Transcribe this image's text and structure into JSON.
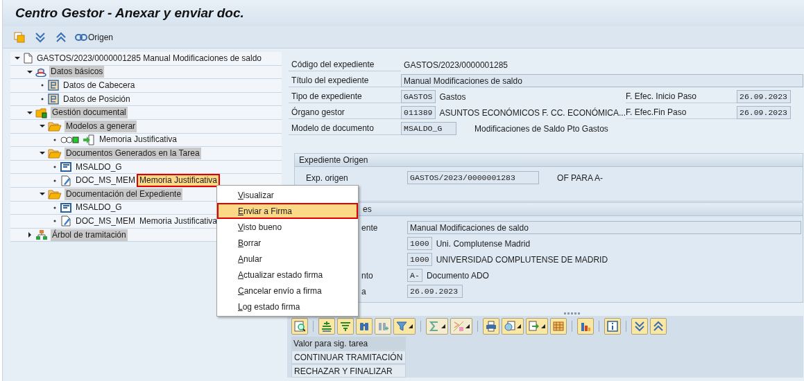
{
  "window": {
    "title": "Centro Gestor - Anexar y enviar doc."
  },
  "toolbar": {
    "items": [
      {
        "kind": "icon"
      },
      {
        "kind": "icon"
      },
      {
        "kind": "icon"
      },
      {
        "kind": "link",
        "label": "Origen"
      }
    ]
  },
  "tree": [
    {
      "kind": "document",
      "label": "GASTOS/2023/0000001285 Manual Modificaciones de saldo",
      "highlighted": false,
      "expanded": true,
      "children": [
        {
          "kind": "service",
          "label": "Datos básicos",
          "highlighted": true,
          "expanded": true,
          "children": [
            {
              "kind": "structure",
              "label": "Datos de Cabecera",
              "highlighted": false
            },
            {
              "kind": "structure",
              "label": "Datos de Posición",
              "highlighted": false
            }
          ]
        },
        {
          "kind": "folder-mixed",
          "label": "Gestión documental",
          "highlighted": true,
          "expanded": true,
          "children": [
            {
              "kind": "folder",
              "label": "Modelos a generar",
              "highlighted": true,
              "expanded": true,
              "children": [
                {
                  "kind": "model",
                  "label": "Memoria Justificativa",
                  "highlighted": false
                }
              ]
            },
            {
              "kind": "folder",
              "label": "Documentos Generados en la Tarea",
              "highlighted": true,
              "expanded": true,
              "children": [
                {
                  "kind": "template",
                  "label": "MSALDO_G",
                  "highlighted": false
                },
                {
                  "kind": "edit",
                  "label": "DOC_MS_MEM",
                  "description": "Memoria Justificativa",
                  "selected": true,
                  "highlighted": false
                }
              ]
            },
            {
              "kind": "folder",
              "label": "Documentación del Expediente",
              "highlighted": true,
              "expanded": true,
              "children": [
                {
                  "kind": "template",
                  "label": "MSALDO_G",
                  "highlighted": false
                },
                {
                  "kind": "edit",
                  "label": "DOC_MS_MEM",
                  "description": "Memoria Justificativa",
                  "selected": false,
                  "highlighted": false
                }
              ]
            }
          ]
        },
        {
          "kind": "hierarchy",
          "label": "Árbol de tramitación",
          "highlighted": true,
          "expanded": false
        }
      ]
    }
  ],
  "header_fields": [
    {
      "kind": "text",
      "label": "Código del expediente",
      "value": "GASTOS/2023/0000001285"
    },
    {
      "kind": "wide",
      "label": "Título del expediente",
      "value": "Manual Modificaciones de saldo"
    },
    {
      "kind": "code",
      "label": "Tipo de expediente",
      "code": "GASTOS",
      "text": "Gastos",
      "side_label": "F. Efec. Inicio Paso",
      "side_value": "26.09.2023"
    },
    {
      "kind": "code",
      "label": "Órgano gestor",
      "code": "011389",
      "text": "ASUNTOS ECONÓMICOS F. CC. ECONÓMICA...",
      "side_label": "F. Efec.Fin Paso",
      "side_value": "26.09.2023"
    },
    {
      "kind": "code",
      "label": "Modelo de documento",
      "code": "MSALDO_G",
      "text": "Modificaciones de Saldo Pto Gastos"
    }
  ],
  "groups": [
    {
      "title": "Expediente Origen",
      "rows": [
        {
          "kind": "code",
          "label": "Exp. origen",
          "code": "GASTOS/2023/0000001283",
          "text": "OF PARA A-"
        }
      ]
    },
    {
      "title": "es",
      "rows": [
        {
          "kind": "wide",
          "label": "ente",
          "value": "Manual Modificaciones de saldo"
        },
        {
          "kind": "code",
          "code": "1000",
          "text": "Uni. Complutense Madrid"
        },
        {
          "kind": "code",
          "code": "1000",
          "text": "UNIVERSIDAD COMPLUTENSE DE MADRID"
        },
        {
          "kind": "code",
          "label": "nto",
          "code": "A-",
          "text": "Documento ADO"
        },
        {
          "kind": "code",
          "label": "a",
          "code": "26.09.2023"
        }
      ]
    }
  ],
  "context_menu": [
    {
      "label": "Visualizar",
      "selected": false
    },
    {
      "label": "Enviar a Firma",
      "selected": true
    },
    {
      "label": "Visto bueno",
      "selected": false
    },
    {
      "label": "Borrar",
      "selected": false
    },
    {
      "label": "Anular",
      "selected": false
    },
    {
      "label": "Actualizar estado firma",
      "selected": false
    },
    {
      "label": "Cancelar envío a firma",
      "selected": false
    },
    {
      "label": "Log estado firma",
      "selected": false
    }
  ],
  "task_table": {
    "columns": [
      "Valor para sig. tarea"
    ],
    "rows": [
      [
        "CONTINUAR TRAMITACIÓN"
      ],
      [
        "RECHAZAR Y FINALIZAR"
      ]
    ]
  }
}
